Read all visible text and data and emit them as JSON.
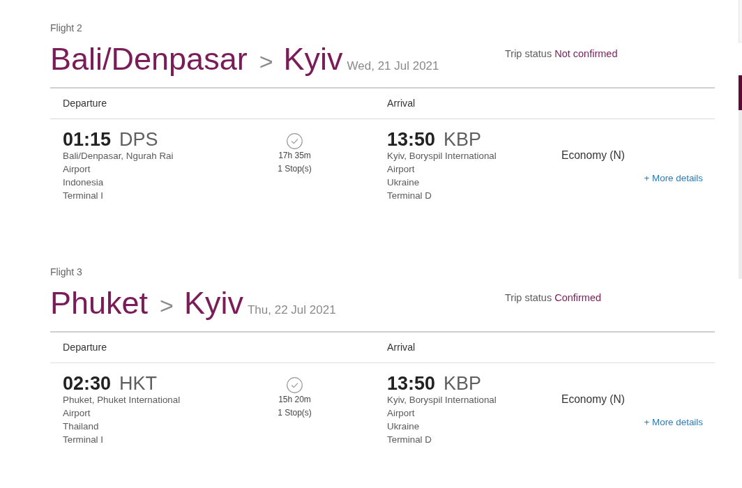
{
  "flights": [
    {
      "label": "Flight 2",
      "origin": "Bali/Denpasar",
      "separator": ">",
      "destination": "Kyiv",
      "date": "Wed, 21 Jul 2021",
      "status_label": "Trip status",
      "status": "Not confirmed",
      "columns": [
        "Departure",
        "Arrival"
      ],
      "departure": {
        "time": "01:15",
        "code": "DPS",
        "airport": "Bali/Denpasar, Ngurah Rai Airport",
        "country": "Indonesia",
        "terminal": "Terminal I"
      },
      "duration": "17h 35m",
      "stops": "1 Stop(s)",
      "arrival": {
        "time": "13:50",
        "code": "KBP",
        "airport": "Kyiv, Boryspil International Airport",
        "country": "Ukraine",
        "terminal": "Terminal D"
      },
      "cabin": "Economy (N)",
      "more_details": "+ More details"
    },
    {
      "label": "Flight 3",
      "origin": "Phuket",
      "separator": ">",
      "destination": "Kyiv",
      "date": "Thu, 22 Jul 2021",
      "status_label": "Trip status",
      "status": "Confirmed",
      "columns": [
        "Departure",
        "Arrival"
      ],
      "departure": {
        "time": "02:30",
        "code": "HKT",
        "airport": "Phuket, Phuket International Airport",
        "country": "Thailand",
        "terminal": "Terminal I"
      },
      "duration": "15h 20m",
      "stops": "1 Stop(s)",
      "arrival": {
        "time": "13:50",
        "code": "KBP",
        "airport": "Kyiv, Boryspil International Airport",
        "country": "Ukraine",
        "terminal": "Terminal D"
      },
      "cabin": "Economy (N)",
      "more_details": "+ More details"
    }
  ]
}
